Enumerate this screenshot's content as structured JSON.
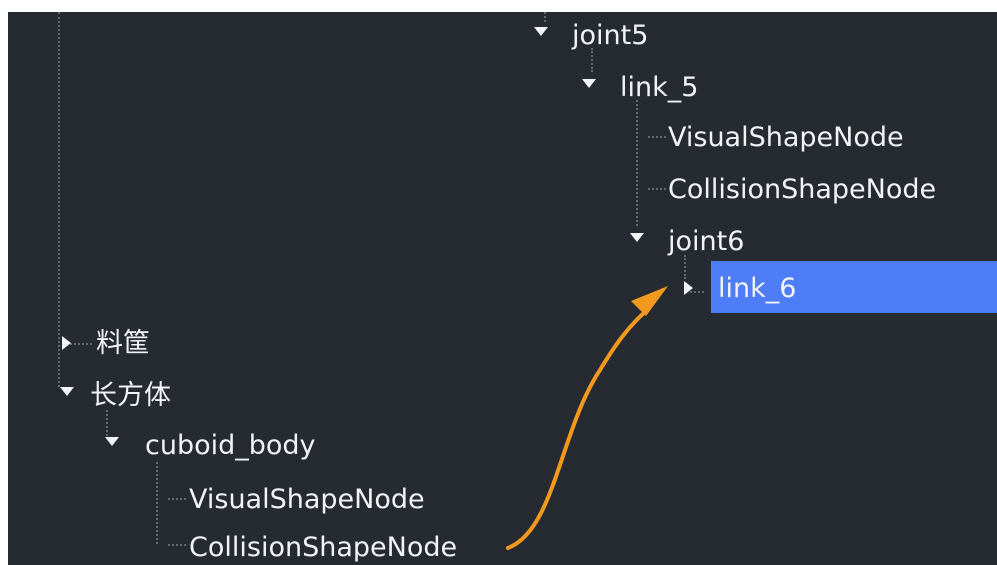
{
  "tree": {
    "items": [
      {
        "label": "joint5",
        "expanded": true
      },
      {
        "label": "link_5",
        "expanded": true
      },
      {
        "label": "VisualShapeNode"
      },
      {
        "label": "CollisionShapeNode"
      },
      {
        "label": "joint6",
        "expanded": true
      },
      {
        "label": "link_6",
        "expanded": false,
        "selected": true
      },
      {
        "label": "料筐",
        "expanded": false
      },
      {
        "label": "长方体",
        "expanded": true
      },
      {
        "label": "cuboid_body",
        "expanded": true
      },
      {
        "label": "VisualShapeNode"
      },
      {
        "label": "CollisionShapeNode"
      }
    ]
  },
  "colors": {
    "panel": "#262b31",
    "text": "#f1f3f6",
    "selection": "#4f7df8",
    "annotation_arrow": "#f39a1e"
  }
}
